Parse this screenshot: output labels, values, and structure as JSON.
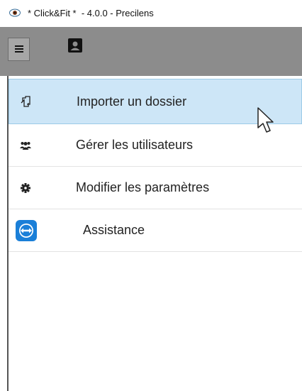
{
  "window": {
    "title": "* Click&Fit *  - 4.0.0 - Precilens",
    "app_icon": "eye-icon"
  },
  "toolbar": {
    "menu_icon": "hamburger-icon",
    "profile_icon": "user-profile-icon"
  },
  "menu": {
    "items": [
      {
        "label": "Importer un dossier",
        "icon": "import-icon"
      },
      {
        "label": "Gérer les utilisateurs",
        "icon": "users-icon"
      },
      {
        "label": "Modifier les paramètres",
        "icon": "gear-icon"
      },
      {
        "label": "Assistance",
        "icon": "teamviewer-icon"
      }
    ]
  },
  "colors": {
    "toolbar_bg": "#8c8c8c",
    "active_item_bg": "#cde6f7",
    "teamviewer_blue": "#1a7fd8"
  }
}
